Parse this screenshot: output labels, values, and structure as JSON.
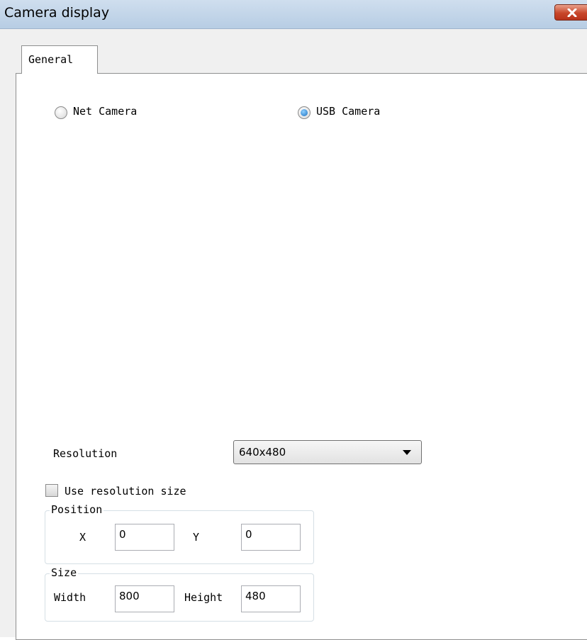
{
  "window": {
    "title": "Camera display"
  },
  "tabs": [
    {
      "label": "General"
    }
  ],
  "camera_type": {
    "options": [
      {
        "label": "Net Camera",
        "selected": false
      },
      {
        "label": "USB Camera",
        "selected": true
      }
    ]
  },
  "resolution": {
    "label": "Resolution",
    "value": "640x480"
  },
  "use_resolution_size": {
    "label": "Use resolution size",
    "checked": false
  },
  "position": {
    "title": "Position",
    "x_label": "X",
    "x_value": "0",
    "y_label": "Y",
    "y_value": "0"
  },
  "size": {
    "title": "Size",
    "width_label": "Width",
    "width_value": "800",
    "height_label": "Height",
    "height_value": "480"
  },
  "icons": {
    "close": "close-icon",
    "dropdown": "chevron-down-icon"
  },
  "colors": {
    "titlebar": "#bdd1e7",
    "close_button": "#c8462a",
    "radio_accent": "#1a6fc0"
  }
}
